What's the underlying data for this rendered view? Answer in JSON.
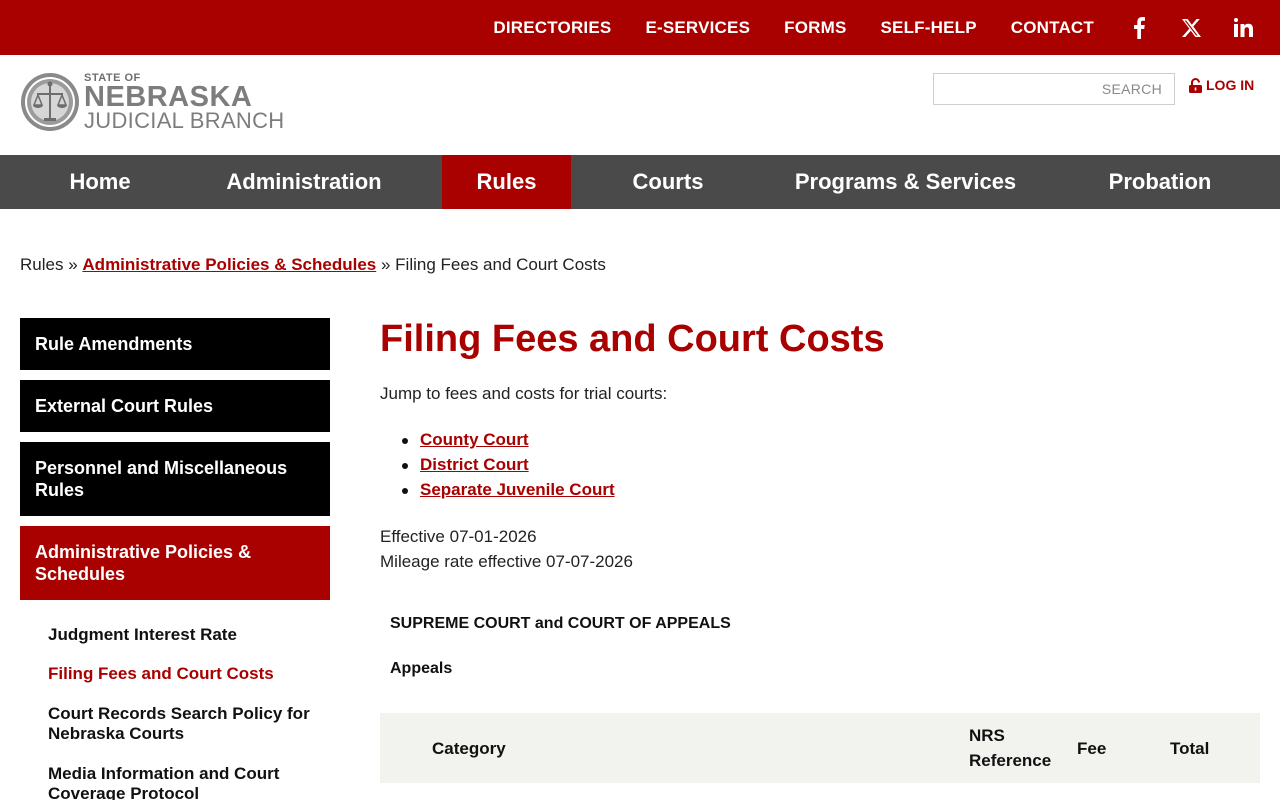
{
  "utility": {
    "links": [
      "DIRECTORIES",
      "E-SERVICES",
      "FORMS",
      "SELF-HELP",
      "CONTACT"
    ],
    "social": [
      "facebook-icon",
      "x-icon",
      "linkedin-icon"
    ]
  },
  "header": {
    "logo": {
      "state_of": "STATE OF",
      "name": "NEBRASKA",
      "branch": "JUDICIAL BRANCH"
    },
    "search_placeholder": "SEARCH",
    "login_label": "LOG IN"
  },
  "nav": {
    "items": [
      "Home",
      "Administration",
      "Rules",
      "Courts",
      "Programs & Services",
      "Probation"
    ],
    "active": "Rules"
  },
  "breadcrumb": {
    "root": "Rules",
    "sep": "»",
    "link": "Administrative Policies & Schedules",
    "current": "Filing Fees and Court Costs"
  },
  "sidebar": {
    "items": [
      "Rule Amendments",
      "External Court Rules",
      "Personnel and Miscellaneous Rules",
      "Administrative Policies & Schedules"
    ],
    "subitems": [
      "Judgment Interest Rate",
      "Filing Fees and Court Costs",
      "Court Records Search Policy for Nebraska Courts",
      "Media Information and Court Coverage Protocol"
    ]
  },
  "content": {
    "title": "Filing Fees and Court Costs",
    "intro": "Jump to fees and costs for trial courts:",
    "jump_links": [
      "County Court",
      "District Court",
      "Separate Juvenile Court"
    ],
    "effective": "Effective 07-01-2026",
    "mileage": "Mileage rate effective 07-07-2026",
    "section_heading": "SUPREME COURT and COURT OF APPEALS",
    "subsection_heading": "Appeals",
    "table_headers": {
      "category": "Category",
      "nrs_1": "NRS",
      "nrs_2": "Reference",
      "fee": "Fee",
      "total": "Total"
    }
  },
  "colors": {
    "brand_red": "#a90000",
    "nav_gray": "#4a4a4a",
    "table_head_bg": "#f2f2ef"
  }
}
